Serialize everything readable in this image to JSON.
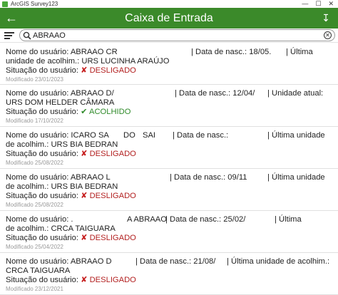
{
  "window": {
    "title": "ArcGIS Survey123",
    "minimize": "—",
    "maximize": "☐",
    "close": "✕"
  },
  "header": {
    "title": "Caixa de Entrada"
  },
  "search": {
    "value": "ABRAAO",
    "placeholder": ""
  },
  "labels": {
    "nome": "Nome do usuário:",
    "nasc": "Data de nasc.:",
    "situacao": "Situação do usuário:",
    "ultima": "Última",
    "unidade_acolhim": "unidade de acolhim.:",
    "unidade_atual": "Unidade atual:",
    "ultima_unidade": "Última unidade",
    "de_acolhim": "de acolhim.:",
    "ultima_unidade_acolhim": "Última unidade de acolhim.:",
    "sep": "|"
  },
  "records": [
    {
      "name": "ABRAAO CR",
      "dob": "18/05.",
      "unit": "URS LUCINHA ARAÚJO",
      "status": "DESLIGADO",
      "status_mark": "✘",
      "modified": "Modificado 23/01/2023"
    },
    {
      "name": "ABRAAO D/",
      "dob": "12/04/",
      "unit": "URS DOM HELDER CÂMARA",
      "status": "ACOLHIDO",
      "status_mark": "✔",
      "modified": "Modificado 17/10/2022"
    },
    {
      "name": "ICARO SA",
      "name_b": "DO",
      "name_c": "SAI",
      "dob": "",
      "unit": "URS BIA BEDRAN",
      "status": "DESLIGADO",
      "status_mark": "✘",
      "modified": "Modificado 25/08/2022"
    },
    {
      "name": "ABRAAO L",
      "dob": "09/11",
      "unit": "URS BIA BEDRAN",
      "status": "DESLIGADO",
      "status_mark": "✘",
      "modified": "Modificado 25/08/2022"
    },
    {
      "name": "A ABRAAO",
      "name_pre": ".",
      "dob": "25/02/",
      "unit": "CRCA TAIGUARA",
      "status": "DESLIGADO",
      "status_mark": "✘",
      "modified": "Modificado 25/04/2022"
    },
    {
      "name": "ABRAAO D",
      "dob": "21/08/",
      "unit": "CRCA TAIGUARA",
      "status": "DESLIGADO",
      "status_mark": "✘",
      "modified": "Modificado 23/12/2021"
    }
  ]
}
